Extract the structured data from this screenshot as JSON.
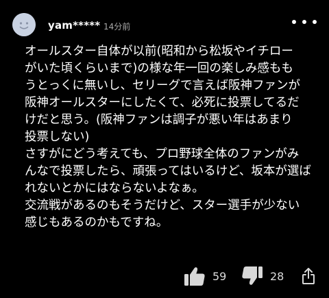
{
  "comment": {
    "username": "yam*****",
    "timestamp": "14分前",
    "body_lines": [
      "オールスター自体が以前(昭和から松坂やイチロー",
      "がいた頃くらいまで)の様な年一回の楽しみ感もも",
      "うとっくに無いし、セリーグで言えば阪神ファンが",
      "阪神オールスターにしたくて、必死に投票してるだ",
      "けだと思う。(阪神ファンは調子が悪い年はあまり",
      "投票しない)",
      "さすがにどう考えても、プロ野球全体のファンがみ",
      "んなで投票したら、頑張ってはいるけど、坂本が選ば",
      "れないとかにはならないよなぁ。",
      "交流戦があるのもそうだけど、スター選手が少ない",
      "感じもあるのかもですね。"
    ]
  },
  "actions": {
    "like_icon": "thumbs-up-icon",
    "like_count": "59",
    "dislike_icon": "thumbs-down-icon",
    "dislike_count": "28",
    "share_icon": "share-icon"
  },
  "header": {
    "more_icon": "more-horizontal-icon"
  },
  "colors": {
    "background": "#000000",
    "text": "#ffffff",
    "muted_text": "#a8a8a8",
    "avatar_bg": "#c9d2e2"
  }
}
